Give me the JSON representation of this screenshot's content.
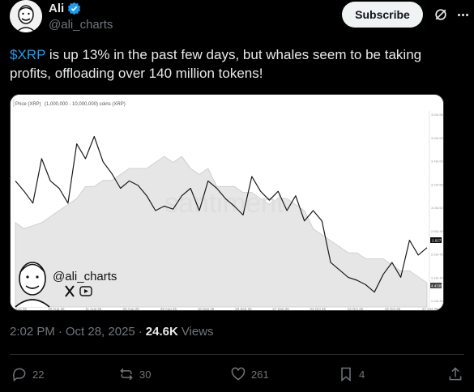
{
  "author": {
    "name": "Ali",
    "handle": "@ali_charts"
  },
  "header": {
    "subscribe_label": "Subscribe",
    "grok_icon": "grok-icon",
    "more_icon": "more-icon"
  },
  "tweet": {
    "cashtag": "$XRP",
    "text_rest": " is up 13% in the past few days, but whales seem to be taking profits, offloading over 140 million tokens!"
  },
  "media": {
    "legend_price": "Price (XRP)",
    "legend_holders": "(1,000,000 - 10,000,000) coins (XRP)",
    "watermark": "santiment",
    "overlay_handle": "@ali_charts",
    "x_ticks": [
      "11 Aug 25",
      "20 Aug 25",
      "11 Aug 25",
      "20 Aug 25",
      "29 Aug 25",
      "10 Sep 25",
      "18 Sep 25",
      "27 Sep 25",
      "04 Oct 25",
      "13 Oct 25",
      "18 Oct 25",
      "27 Oct 25"
    ],
    "right_ticks_a": [
      "3.81",
      "3.61",
      "3.41",
      "3.21",
      "3.01",
      "2.81",
      "2.61",
      "2.41",
      "2.21"
    ],
    "right_ticks_b": [
      "4.665B",
      "4.630B",
      "4.595B",
      "4.560B",
      "4.525B",
      "4.490B",
      "4.455B",
      "4.420B",
      "4.385B"
    ],
    "price_marker": "2.627",
    "holders_marker": "4.433B"
  },
  "chart_data": {
    "type": "line",
    "series": [
      {
        "name": "Price (XRP)",
        "values": [
          3.05,
          2.98,
          2.9,
          3.2,
          3.05,
          3.0,
          2.9,
          3.3,
          3.2,
          3.35,
          3.18,
          3.1,
          3.0,
          3.05,
          3.02,
          2.95,
          2.85,
          2.88,
          2.86,
          2.95,
          3.0,
          2.85,
          3.05,
          3.0,
          2.93,
          2.88,
          2.82,
          3.08,
          2.98,
          2.92,
          2.98,
          2.85,
          2.95,
          2.78,
          2.85,
          2.78,
          2.5,
          2.45,
          2.4,
          2.38,
          2.35,
          2.3,
          2.42,
          2.5,
          2.4,
          2.65,
          2.55,
          2.6
        ]
      },
      {
        "name": "(1,000,000 - 10,000,000) coins (XRP)",
        "values": [
          4.54,
          4.53,
          4.535,
          4.54,
          4.55,
          4.56,
          4.57,
          4.58,
          4.6,
          4.6,
          4.61,
          4.61,
          4.62,
          4.63,
          4.63,
          4.63,
          4.64,
          4.65,
          4.64,
          4.65,
          4.63,
          4.62,
          4.63,
          4.6,
          4.6,
          4.6,
          4.59,
          4.59,
          4.58,
          4.57,
          4.58,
          4.58,
          4.57,
          4.56,
          4.53,
          4.52,
          4.51,
          4.5,
          4.49,
          4.49,
          4.48,
          4.48,
          4.48,
          4.47,
          4.46,
          4.46,
          4.45,
          4.44
        ]
      }
    ],
    "xlabel": "",
    "ylabel": ""
  },
  "meta": {
    "time": "2:02 PM",
    "dot": "·",
    "date": "Oct 28, 2025",
    "dot2": "·",
    "views_count": "24.6K",
    "views_label": "Views"
  },
  "actions": {
    "replies": "22",
    "reposts": "30",
    "likes": "261",
    "bookmarks": "4"
  }
}
